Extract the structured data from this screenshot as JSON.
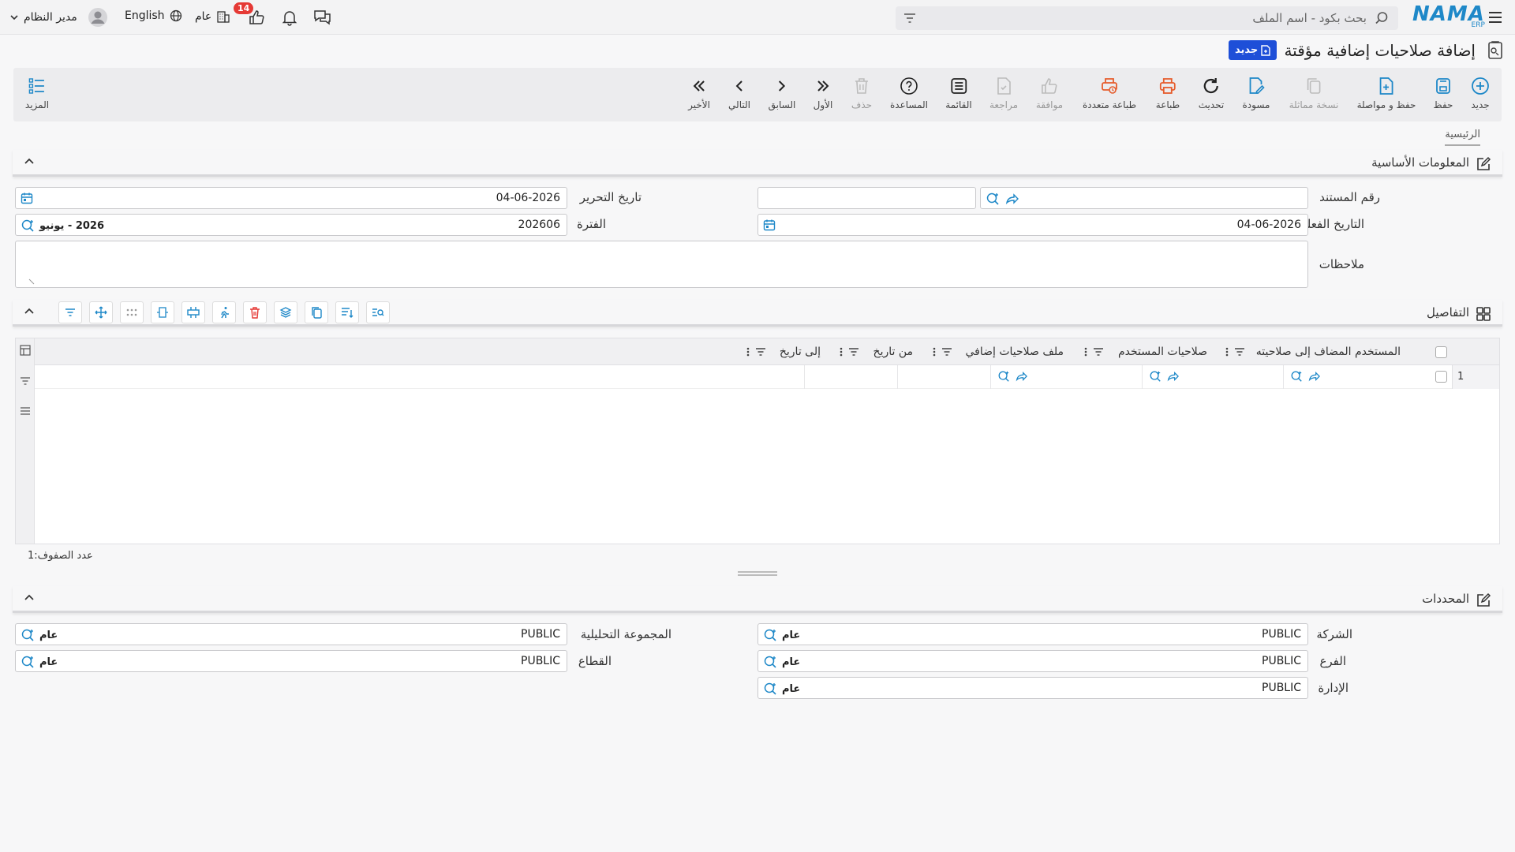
{
  "header": {
    "logo": "NAMA",
    "logo_sub": "ERP",
    "search_placeholder": "بحث بكود - اسم الملف",
    "user_name": "مدير النظام",
    "language": "English",
    "scope": "عام",
    "notifications_count": "14"
  },
  "page": {
    "title": "إضافة صلاحيات إضافية مؤقتة",
    "status_badge": "جديد"
  },
  "toolbar": {
    "new": "جديد",
    "save": "حفظ",
    "save_continue": "حفظ و مواصلة",
    "duplicate": "نسخة مماثلة",
    "draft": "مسودة",
    "refresh": "تحديث",
    "print": "طباعة",
    "multi_print": "طباعة متعددة",
    "approve": "موافقة",
    "review": "مراجعة",
    "list": "القائمة",
    "help": "المساعدة",
    "delete": "حذف",
    "first": "الأول",
    "previous": "السابق",
    "next": "التالي",
    "last": "الأخير",
    "more": "المزيد"
  },
  "tabs": {
    "main": "الرئيسية"
  },
  "basic_info": {
    "section_title": "المعلومات الأساسية",
    "doc_number_label": "رقم المستند",
    "doc_number_value": "",
    "edit_date_label": "تاريخ التحرير",
    "edit_date_value": "04-06-2026",
    "actual_date_label": "التاريخ الفعلي",
    "actual_date_value": "04-06-2026",
    "period_label": "الفترة",
    "period_value": "202606",
    "period_name": "2026 - يونيو",
    "notes_label": "ملاحظات",
    "notes_value": ""
  },
  "details": {
    "section_title": "التفاصيل",
    "columns": [
      "المستخدم المضاف إلى صلاحيته",
      "صلاحيات المستخدم",
      "ملف صلاحيات إضافي",
      "من تاريخ",
      "إلى تاريخ"
    ],
    "row_number": "1",
    "row_count_text": "عدد الصفوف:1"
  },
  "determinants": {
    "section_title": "المحددات",
    "company_label": "الشركة",
    "company_value": "PUBLIC",
    "company_name": "عام",
    "branch_label": "الفرع",
    "branch_value": "PUBLIC",
    "branch_name": "عام",
    "department_label": "الإدارة",
    "department_value": "PUBLIC",
    "department_name": "عام",
    "analytic_label": "المجموعة التحليلية",
    "analytic_value": "PUBLIC",
    "analytic_name": "عام",
    "sector_label": "القطاع",
    "sector_value": "PUBLIC",
    "sector_name": "عام"
  },
  "colors": {
    "accent": "#1e88c8",
    "brand": "#1976d2",
    "danger": "#e53935",
    "orange": "#e65c2c",
    "badge_blue": "#1e4fd8"
  }
}
